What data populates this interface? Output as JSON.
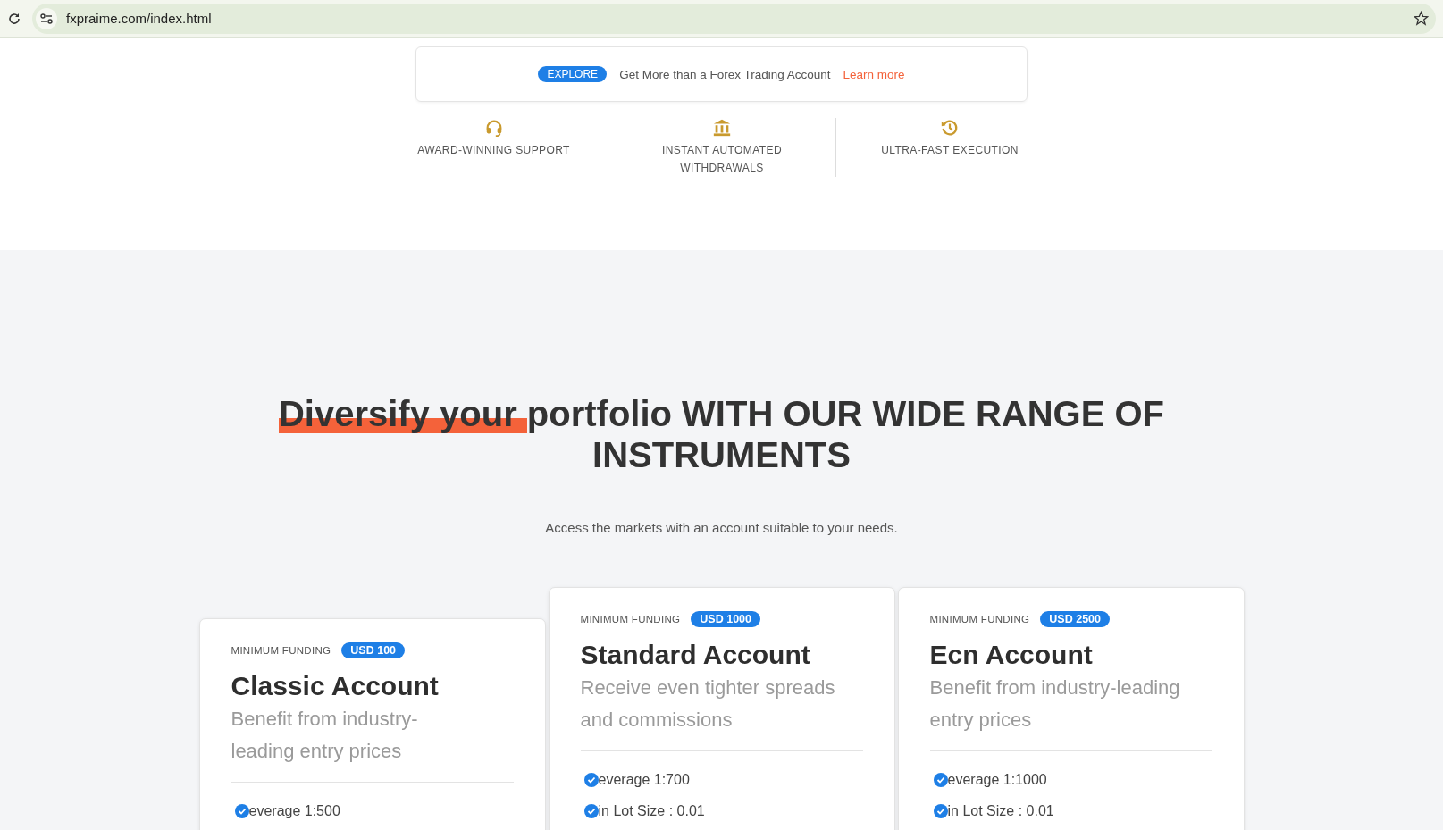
{
  "browser": {
    "url": "fxpraime.com/index.html"
  },
  "banner": {
    "badge": "EXPLORE",
    "text": "Get More than a Forex Trading Account",
    "link": "Learn more"
  },
  "features": [
    {
      "kind": "support",
      "label": "AWARD-WINNING SUPPORT"
    },
    {
      "kind": "bank",
      "label": "INSTANT AUTOMATED WITHDRAWALS"
    },
    {
      "kind": "history",
      "label": "ULTRA-FAST EXECUTION"
    }
  ],
  "heading": {
    "highlight": "Diversify your ",
    "text": "portfolio WITH OUR WIDE RANGE OF INSTRUMENTS"
  },
  "subtitle": "Access the markets with an account suitable to your needs.",
  "accounts": [
    {
      "funding_label": "MINIMUM FUNDING",
      "funding": "USD 100",
      "title": "Classic Account",
      "description": "Benefit from industry-leading entry prices",
      "features": [
        "everage 1:500"
      ]
    },
    {
      "funding_label": "MINIMUM FUNDING",
      "funding": "USD 1000",
      "title": "Standard Account",
      "description": "Receive even tighter spreads and commissions",
      "features": [
        "everage 1:700",
        "in Lot Size : 0.01"
      ]
    },
    {
      "funding_label": "MINIMUM FUNDING",
      "funding": "USD 2500",
      "title": "Ecn Account",
      "description": "Benefit from industry-leading entry prices",
      "features": [
        "everage 1:1000",
        "in Lot Size : 0.01"
      ]
    }
  ]
}
